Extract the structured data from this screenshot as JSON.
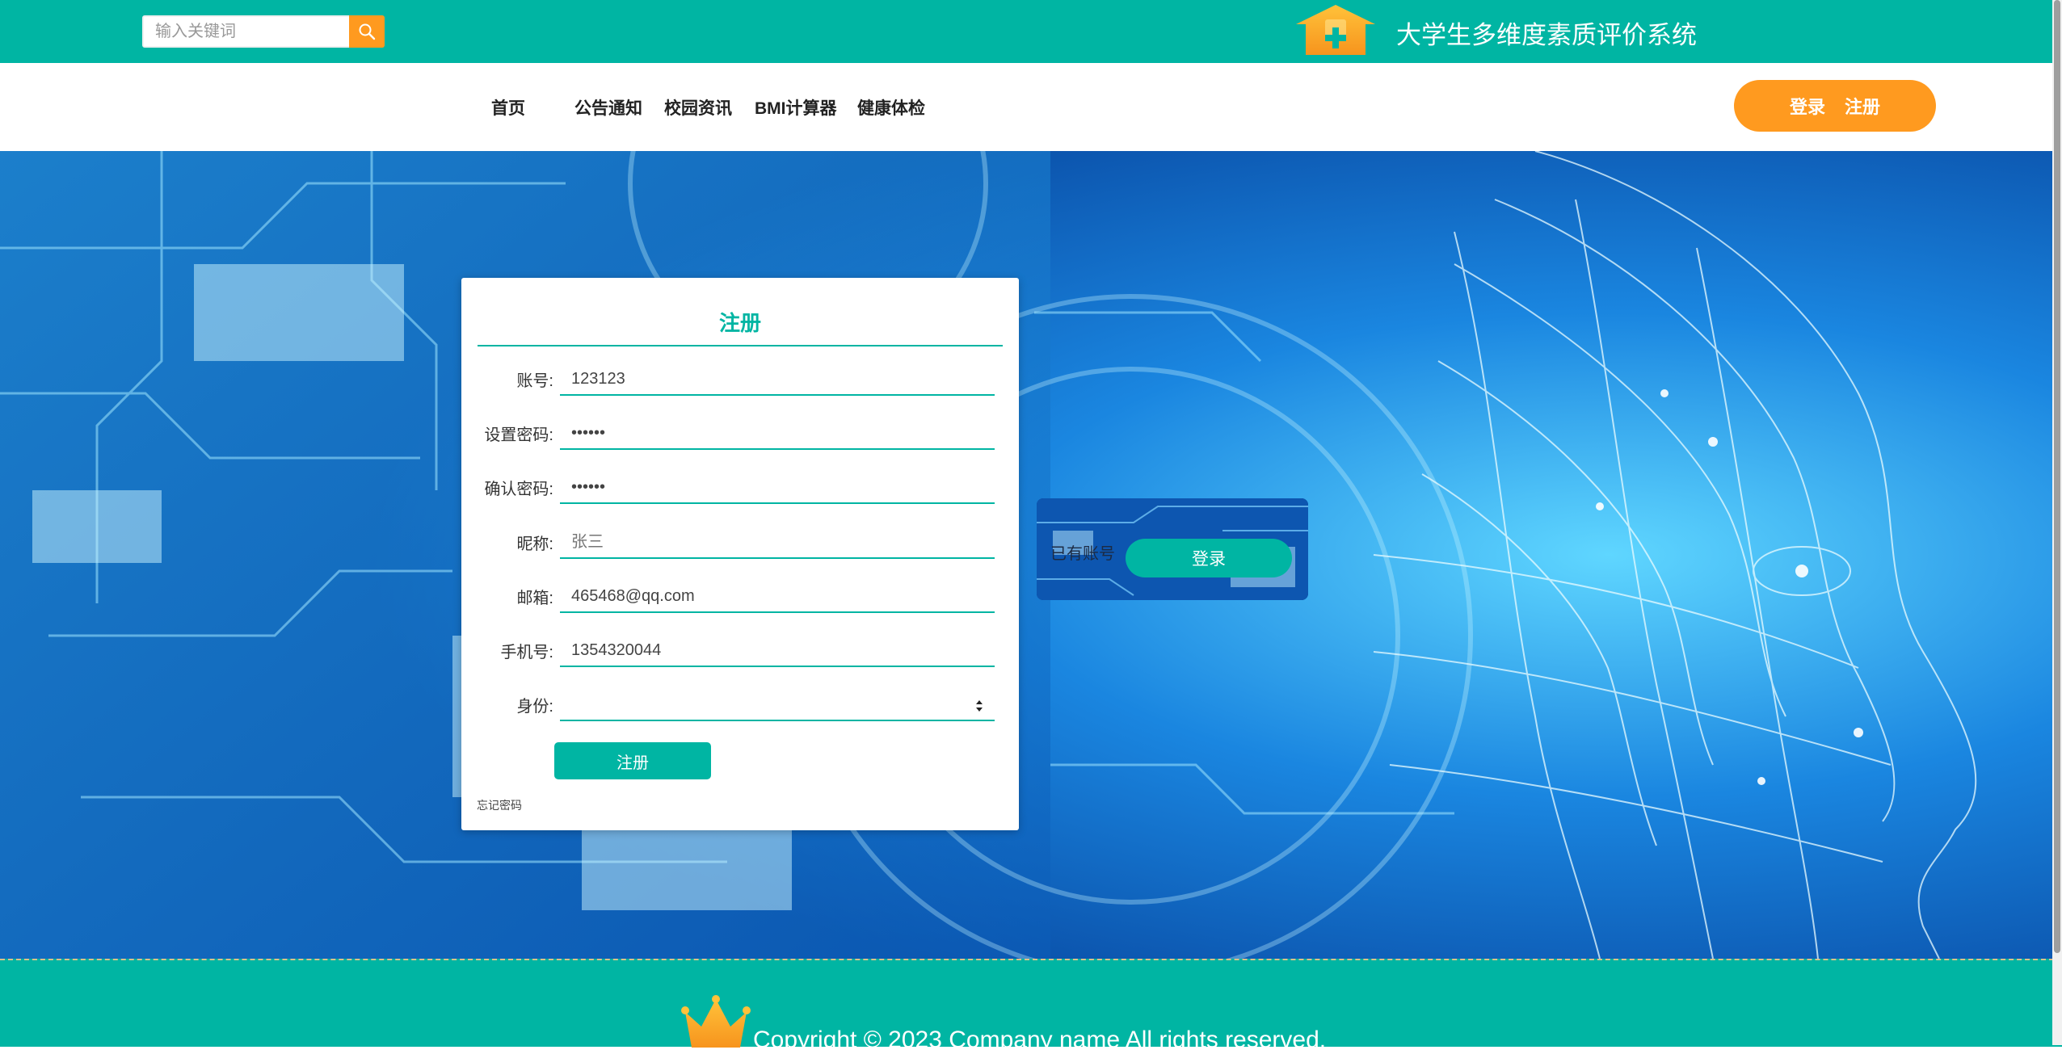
{
  "header": {
    "search_placeholder": "输入关键词",
    "search_icon": "search-icon",
    "logo_icon": "house-plus-icon",
    "site_title": "大学生多维度素质评价系统",
    "accent_color": "#00B5A3",
    "highlight_color": "#FF9A1F"
  },
  "nav": {
    "items": [
      {
        "label": "首页"
      },
      {
        "label": "公告通知"
      },
      {
        "label": "校园资讯"
      },
      {
        "label": "BMI计算器"
      },
      {
        "label": "健康体检"
      }
    ],
    "login_label": "登录",
    "register_label": "注册"
  },
  "form": {
    "title": "注册",
    "fields": [
      {
        "label": "账号:",
        "value": "123123"
      },
      {
        "label": "设置密码:",
        "value": "••••••"
      },
      {
        "label": "确认密码:",
        "value": "••••••"
      },
      {
        "label": "昵称:",
        "value": "",
        "placeholder": "张三"
      },
      {
        "label": "邮箱:",
        "value": "465468@qq.com"
      },
      {
        "label": "手机号:",
        "value": "1354320044"
      },
      {
        "label": "身份:",
        "value": ""
      }
    ],
    "submit_label": "注册",
    "forgot_label": "忘记密码"
  },
  "side": {
    "text": "已有账号",
    "login_label": "登录"
  },
  "footer": {
    "crown_icon": "crown-icon",
    "copyright": "Copyright © 2023 Company name All rights reserved."
  }
}
